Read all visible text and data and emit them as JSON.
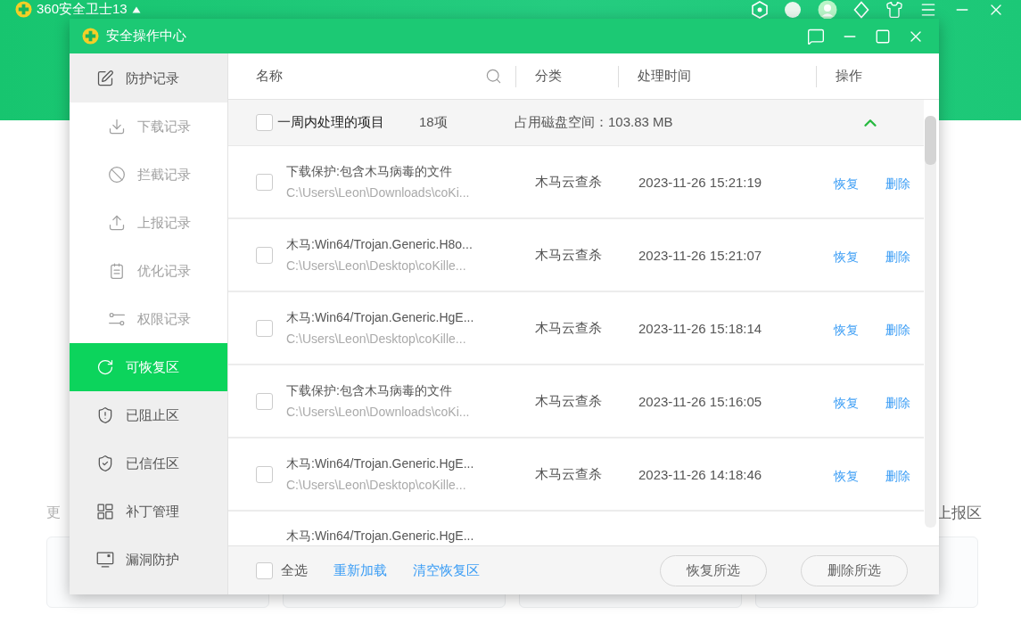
{
  "app": {
    "title": "360安全卫士13",
    "more_label": "更",
    "report_label": "上报区"
  },
  "dialog": {
    "title": "安全操作中心"
  },
  "sidebar": {
    "items": [
      {
        "label": "防护记录",
        "selected": false,
        "children": [
          {
            "label": "下载记录",
            "selected": false
          },
          {
            "label": "拦截记录",
            "selected": false
          },
          {
            "label": "上报记录",
            "selected": false
          },
          {
            "label": "优化记录",
            "selected": false
          },
          {
            "label": "权限记录",
            "selected": false
          }
        ]
      },
      {
        "label": "可恢复区",
        "selected": true
      },
      {
        "label": "已阻止区",
        "selected": false
      },
      {
        "label": "已信任区",
        "selected": false
      },
      {
        "label": "补丁管理",
        "selected": false
      },
      {
        "label": "漏洞防护",
        "selected": false
      }
    ]
  },
  "table": {
    "columns": [
      "名称",
      "分类",
      "处理时间",
      "操作"
    ],
    "group": {
      "label": "一周内处理的项目",
      "checked": false,
      "count": "18项",
      "disk_usage": "占用磁盘空间：103.83 MB",
      "expanded": true
    },
    "rows": [
      {
        "checked": false,
        "name": "下载保护:包含木马病毒的文件",
        "path": "C:\\Users\\Leon\\Downloads\\coKi...",
        "category": "木马云查杀",
        "time": "2023-11-26 15:21:19",
        "actions": [
          "恢复",
          "删除"
        ]
      },
      {
        "checked": false,
        "name": "木马:Win64/Trojan.Generic.H8o...",
        "path": "C:\\Users\\Leon\\Desktop\\coKille...",
        "category": "木马云查杀",
        "time": "2023-11-26 15:21:07",
        "actions": [
          "恢复",
          "删除"
        ]
      },
      {
        "checked": false,
        "name": "木马:Win64/Trojan.Generic.HgE...",
        "path": "C:\\Users\\Leon\\Desktop\\coKille...",
        "category": "木马云查杀",
        "time": "2023-11-26 15:18:14",
        "actions": [
          "恢复",
          "删除"
        ]
      },
      {
        "checked": false,
        "name": "下载保护:包含木马病毒的文件",
        "path": "C:\\Users\\Leon\\Downloads\\coKi...",
        "category": "木马云查杀",
        "time": "2023-11-26 15:16:05",
        "actions": [
          "恢复",
          "删除"
        ]
      },
      {
        "checked": false,
        "name": "木马:Win64/Trojan.Generic.HgE...",
        "path": "C:\\Users\\Leon\\Desktop\\coKille...",
        "category": "木马云查杀",
        "time": "2023-11-26 14:18:46",
        "actions": [
          "恢复",
          "删除"
        ]
      },
      {
        "name": "木马:Win64/Trojan.Generic.HgE..."
      }
    ]
  },
  "footer": {
    "select_all": {
      "label": "全选",
      "checked": false
    },
    "links": [
      "重新加载",
      "清空恢复区"
    ],
    "buttons": [
      "恢复所选",
      "删除所选"
    ]
  }
}
